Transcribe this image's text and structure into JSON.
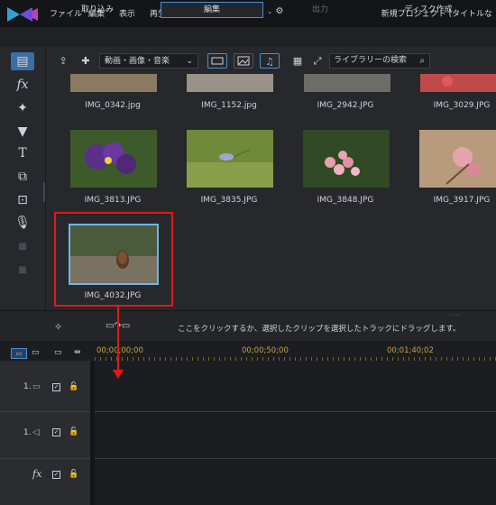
{
  "menu": {
    "items": [
      "ファイル",
      "編集",
      "表示",
      "再生"
    ],
    "title": "新規プロジェクト (タイトルな"
  },
  "modes": {
    "capture": "取り込み",
    "edit": "編集",
    "output": "出力",
    "disc": "ディスク作成"
  },
  "library": {
    "filter_value": "動画・画像・音楽",
    "search_placeholder": "ライブラリーの検索",
    "items": [
      {
        "name": "IMG_0342.jpg"
      },
      {
        "name": "IMG_1152.jpg"
      },
      {
        "name": "IMG_2942.JPG"
      },
      {
        "name": "IMG_3029.JPG"
      },
      {
        "name": "IMG_3813.JPG"
      },
      {
        "name": "IMG_3835.JPG"
      },
      {
        "name": "IMG_3848.JPG"
      },
      {
        "name": "IMG_3917.JPG"
      },
      {
        "name": "IMG_4032.JPG"
      }
    ]
  },
  "hint": {
    "text": "ここをクリックするか、選択したクリップを選択したトラックにドラッグします。"
  },
  "timeline": {
    "ruler": [
      "00;00;00;00",
      "00;00;50;00",
      "00;01;40;02"
    ],
    "tracks": [
      {
        "number": "1.",
        "type_icon": "video-track-icon"
      },
      {
        "number": "1.",
        "type_icon": "audio-track-icon"
      },
      {
        "number": "",
        "type_icon": "fx-track-icon",
        "label": "fx"
      }
    ]
  },
  "colors": {
    "accent": "#4a8fd0",
    "highlight": "#e01818",
    "timecode": "#c8a23a"
  }
}
